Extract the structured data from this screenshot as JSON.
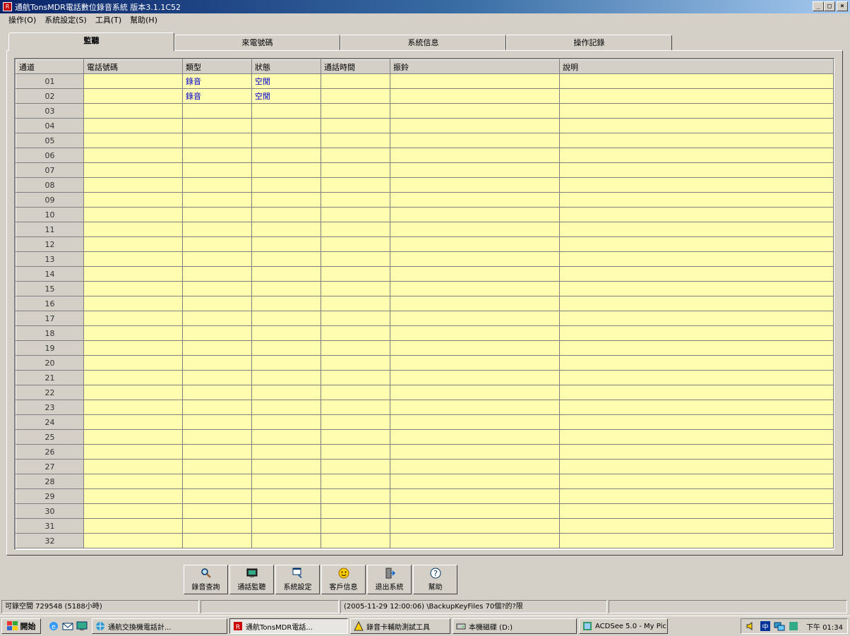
{
  "window": {
    "title": "通航TonsMDR電話數位錄音系統 版本3.1.1C52",
    "icon_letter": "R",
    "buttons": {
      "minimize": "_",
      "maximize": "□",
      "close": "×"
    }
  },
  "menu": [
    "操作(O)",
    "系統設定(S)",
    "工具(T)",
    "幫助(H)"
  ],
  "tabs": [
    "監聽",
    "來電號碼",
    "系統信息",
    "操作記錄"
  ],
  "grid": {
    "columns": [
      "通道",
      "電話號碼",
      "類型",
      "狀態",
      "通話時間",
      "振鈴",
      "說明"
    ],
    "rows": [
      {
        "ch": "01",
        "type": "錄音",
        "status": "空閒"
      },
      {
        "ch": "02",
        "type": "錄音",
        "status": "空閒"
      },
      {
        "ch": "03"
      },
      {
        "ch": "04"
      },
      {
        "ch": "05"
      },
      {
        "ch": "06"
      },
      {
        "ch": "07"
      },
      {
        "ch": "08"
      },
      {
        "ch": "09"
      },
      {
        "ch": "10"
      },
      {
        "ch": "11"
      },
      {
        "ch": "12"
      },
      {
        "ch": "13"
      },
      {
        "ch": "14"
      },
      {
        "ch": "15"
      },
      {
        "ch": "16"
      },
      {
        "ch": "17"
      },
      {
        "ch": "18"
      },
      {
        "ch": "19"
      },
      {
        "ch": "20"
      },
      {
        "ch": "21"
      },
      {
        "ch": "22"
      },
      {
        "ch": "23"
      },
      {
        "ch": "24"
      },
      {
        "ch": "25"
      },
      {
        "ch": "26"
      },
      {
        "ch": "27"
      },
      {
        "ch": "28"
      },
      {
        "ch": "29"
      },
      {
        "ch": "30"
      },
      {
        "ch": "31"
      },
      {
        "ch": "32"
      }
    ]
  },
  "toolbar": [
    {
      "label": "錄音查詢",
      "icon": "magnifier-icon"
    },
    {
      "label": "通話監聽",
      "icon": "monitor-icon"
    },
    {
      "label": "系統設定",
      "icon": "settings-icon"
    },
    {
      "label": "客戶信息",
      "icon": "customer-icon"
    },
    {
      "label": "退出系統",
      "icon": "exit-door-icon"
    },
    {
      "label": "幫助",
      "icon": "help-icon"
    }
  ],
  "status": {
    "disk": "可錄空間  729548 (5188小時)",
    "blank": "",
    "message": "(2005-11-29 12:00:06)   \\BackupKeyFiles  70個?的?限",
    "tail": ""
  },
  "taskbar": {
    "start": "開始",
    "buttons": [
      {
        "label": "通航交換機電話計...",
        "icon": "globe-icon",
        "active": false
      },
      {
        "label": "通航TonsMDR電話...",
        "icon": "app-icon",
        "active": true
      },
      {
        "label": "錄音卡輔助測試工具",
        "icon": "tool-icon",
        "active": false
      },
      {
        "label": "本機磁碟 (D:)",
        "icon": "drive-icon",
        "active": false
      },
      {
        "label": "ACDSee 5.0 - My Pic...",
        "icon": "acdsee-icon",
        "active": false
      }
    ],
    "clock": "下午 01:34"
  },
  "colors": {
    "cell_bg": "#fffdb0",
    "value_text": "#0000cc",
    "title_gradient_start": "#0a246a"
  }
}
